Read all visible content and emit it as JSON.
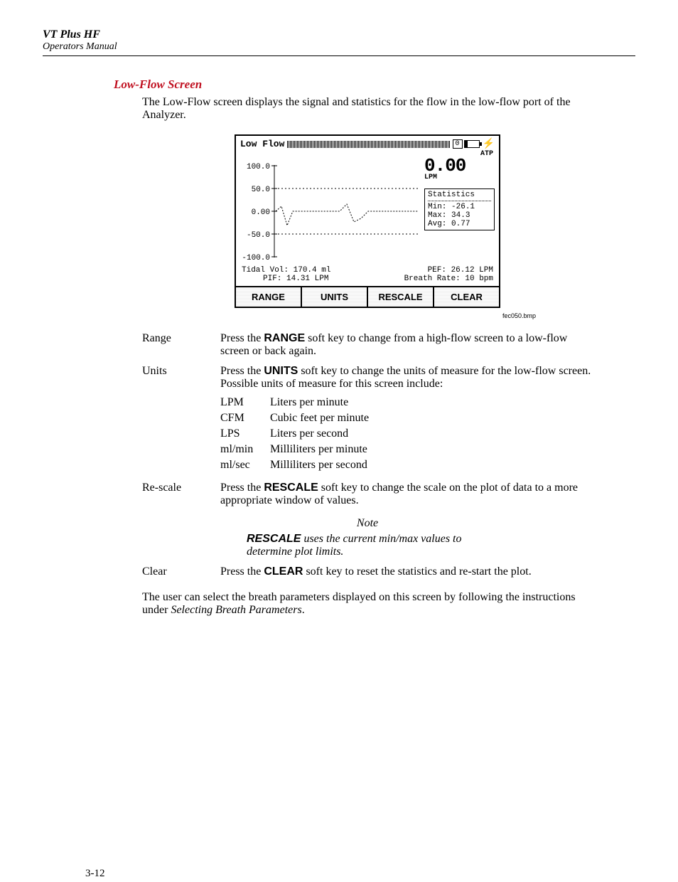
{
  "header": {
    "title": "VT Plus HF",
    "subtitle": "Operators Manual"
  },
  "section": {
    "title": "Low-Flow Screen",
    "intro": "The Low-Flow screen displays the signal and statistics for the flow in the low-flow port of the Analyzer."
  },
  "lcd": {
    "title": "Low Flow",
    "top_zero": "0",
    "atp": "ATP",
    "reading": {
      "value": "0.00",
      "unit": "LPM"
    },
    "y_ticks": [
      "100.0",
      "50.0",
      "0.00",
      "-50.0",
      "-100.0"
    ],
    "stats": {
      "title": "Statistics",
      "min_label": "Min:",
      "min": "-26.1",
      "max_label": "Max:",
      "max": "34.3",
      "avg_label": "Avg:",
      "avg": "0.77"
    },
    "params": {
      "tidal_vol_label": "Tidal Vol:",
      "tidal_vol": "170.4 ml",
      "pif_label": "PIF:",
      "pif": "14.31 LPM",
      "pef_label": "PEF:",
      "pef": "26.12 LPM",
      "breath_rate_label": "Breath Rate:",
      "breath_rate": "10 bpm"
    },
    "softkeys": {
      "range": "RANGE",
      "units": "UNITS",
      "rescale": "RESCALE",
      "clear": "CLEAR"
    }
  },
  "figure_caption": "fec050.bmp",
  "defs": {
    "range": {
      "term": "Range",
      "pre": "Press the ",
      "key": "RANGE",
      "post": " soft key to change from a high-flow screen to a low-flow screen or back again."
    },
    "units": {
      "term": "Units",
      "pre": "Press the ",
      "key": "UNITS",
      "post": " soft key to change the units of measure for the low-flow screen. Possible units of measure for this screen include:",
      "list": [
        {
          "k": "LPM",
          "v": "Liters per minute"
        },
        {
          "k": "CFM",
          "v": "Cubic feet per minute"
        },
        {
          "k": "LPS",
          "v": "Liters per second"
        },
        {
          "k": "ml/min",
          "v": "Milliliters per minute"
        },
        {
          "k": "ml/sec",
          "v": "Milliliters per second"
        }
      ]
    },
    "rescale": {
      "term": "Re-scale",
      "pre": "Press the ",
      "key": "RESCALE",
      "post": " soft key to change the scale on the plot of data to a more appropriate window of values."
    },
    "clear": {
      "term": "Clear",
      "pre": "Press the ",
      "key": "CLEAR",
      "post": " soft key to reset the statistics and re-start the plot."
    }
  },
  "note": {
    "label": "Note",
    "key": "RESCALE",
    "rest": " uses the current min/max values to determine plot limits."
  },
  "closing": {
    "pre": "The user can select the breath parameters displayed on this screen by following the instructions under ",
    "em": "Selecting Breath Parameters",
    "post": "."
  },
  "page_number": "3-12"
}
